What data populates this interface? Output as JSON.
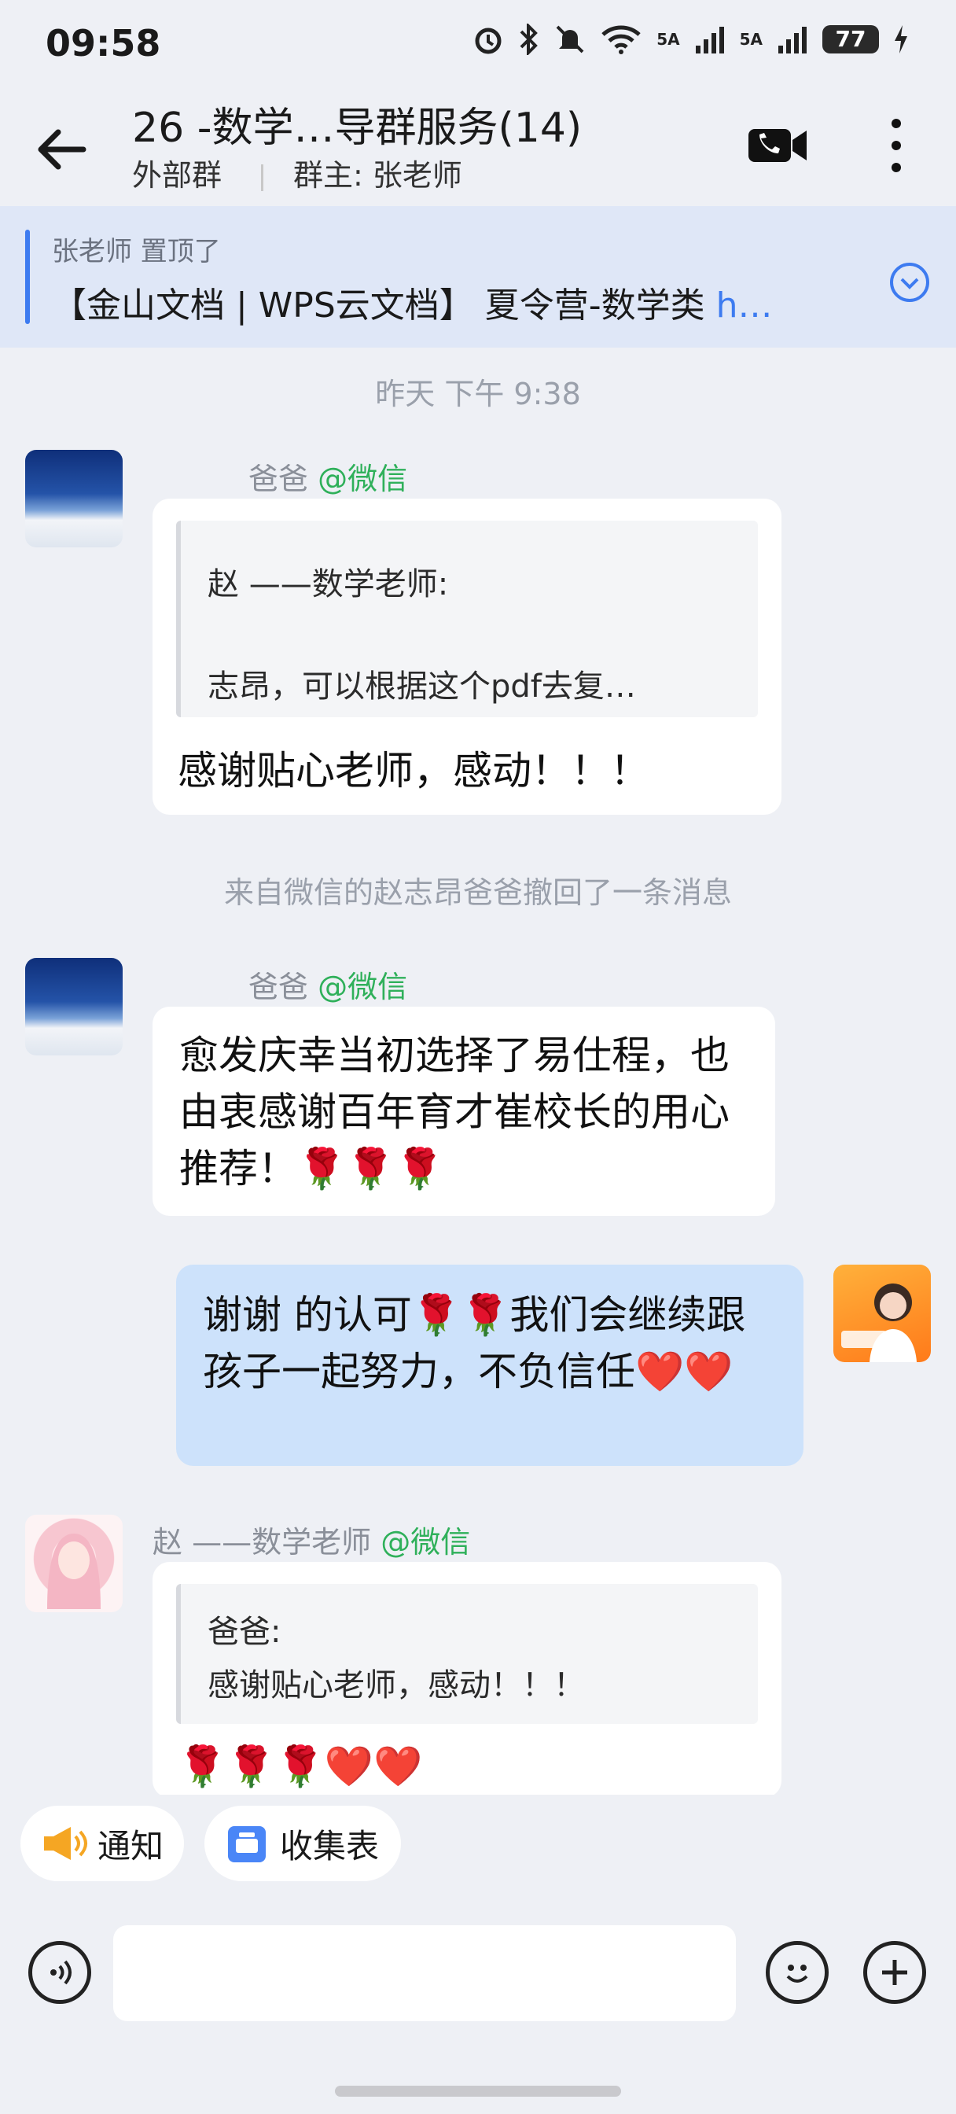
{
  "status_bar": {
    "time": "09:58",
    "battery": "77",
    "signal1": "5A",
    "signal2": "5A"
  },
  "header": {
    "title": "26            -数学…导群服务(14)",
    "subtitle_left": "外部群",
    "subtitle_right": "群主:  张老师"
  },
  "pinned": {
    "by": "张老师 置顶了",
    "text": "【金山文档 | WPS云文档】 夏令营-数学类 ",
    "link": "h…"
  },
  "chat": {
    "timestamp": "昨天  下午 9:38",
    "recall_notice": "来自微信的赵志昂爸爸撤回了一条消息",
    "messages": [
      {
        "sender": "爸爸",
        "source": "@微信",
        "quote_line1": "赵      ——数学老师:",
        "quote_line2": "志昂，可以根据这个pdf去复…",
        "text": "感谢贴心老师，感动！！！"
      },
      {
        "sender": "爸爸",
        "source": "@微信",
        "text": "愈发庆幸当初选择了易仕程，也由衷感谢百年育才崔校长的用心推荐！🌹🌹🌹"
      },
      {
        "text": "谢谢        的认可🌹🌹我们会继续跟孩子一起努力，不负信任❤️❤️"
      },
      {
        "sender": "赵        ——数学老师",
        "source": "@微信",
        "quote_line1": "        爸爸:",
        "quote_line2": "感谢贴心老师，感动！！！",
        "text": "🌹🌹🌹❤️❤️"
      }
    ]
  },
  "quick_actions": {
    "notify": "通知",
    "form": "收集表"
  },
  "colors": {
    "accent": "#3d7bf0",
    "wechat_green": "#2fb05a",
    "bubble_self": "#cde2fb"
  }
}
